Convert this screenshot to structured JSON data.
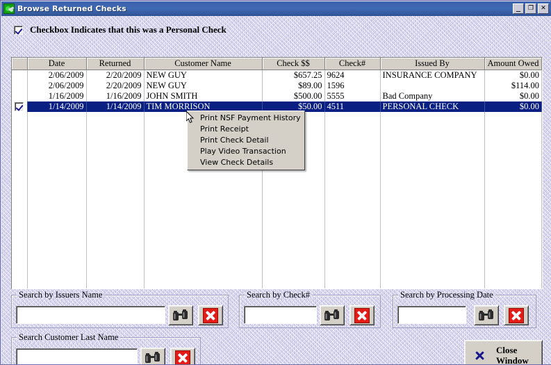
{
  "window": {
    "title": "Browse Returned Checks",
    "icon": "money-checks-icon",
    "minimize_label": "_",
    "maximize_label": "❐",
    "close_label": "✕"
  },
  "personal_check": {
    "checked": true,
    "label": "Checkbox Indicates that this was a Personal Check"
  },
  "grid": {
    "columns": [
      "",
      "Date",
      "Returned",
      "Customer Name",
      "Check $$",
      "Check#",
      "Issued By",
      "Amount Owed"
    ],
    "rows": [
      {
        "personal": false,
        "date": "2/06/2009",
        "returned": "2/20/2009",
        "customer": "NEW GUY",
        "amount": "$657.25",
        "checknum": "9624",
        "issued_by": "INSURANCE COMPANY",
        "owed": "$0.00",
        "selected": false
      },
      {
        "personal": false,
        "date": "2/06/2009",
        "returned": "2/20/2009",
        "customer": "NEW GUY",
        "amount": "$89.00",
        "checknum": "1596",
        "issued_by": "",
        "owed": "$114.00",
        "selected": false
      },
      {
        "personal": false,
        "date": "1/16/2009",
        "returned": "1/16/2009",
        "customer": "JOHN SMITH",
        "amount": "$500.00",
        "checknum": "5555",
        "issued_by": "Bad Company",
        "owed": "$0.00",
        "selected": false
      },
      {
        "personal": true,
        "date": "1/14/2009",
        "returned": "1/14/2009",
        "customer": "TIM MORRISON",
        "amount": "$50.00",
        "checknum": "4511",
        "issued_by": "PERSONAL CHECK",
        "owed": "$0.00",
        "selected": true
      }
    ]
  },
  "context_menu": {
    "items": [
      "Print NSF Payment History",
      "Print Receipt",
      "Print Check Detail",
      "Play Video Transaction",
      "View Check Details"
    ]
  },
  "search_panels": {
    "issuers_name": {
      "title": "Search by Issuers Name",
      "value": "",
      "placeholder": ""
    },
    "check_number": {
      "title": "Search by Check#",
      "value": "",
      "placeholder": ""
    },
    "processing_date": {
      "title": "Search by Processing Date",
      "value": "",
      "placeholder": ""
    },
    "customer_last": {
      "title": "Search Customer Last Name",
      "value": "",
      "placeholder": ""
    }
  },
  "buttons": {
    "find_icon": "binoculars-icon",
    "clear_icon": "red-x-icon",
    "close_window_line1": "Close",
    "close_window_line2": "Window",
    "close_window_icon": "blue-x-icon"
  },
  "colors": {
    "titlebar": "#3a62ab",
    "selection": "#0a1f82",
    "background": "#d6d4ef",
    "control_face": "#d4d0c8",
    "red_accent": "#e41b17",
    "blue_accent": "#16178c"
  }
}
